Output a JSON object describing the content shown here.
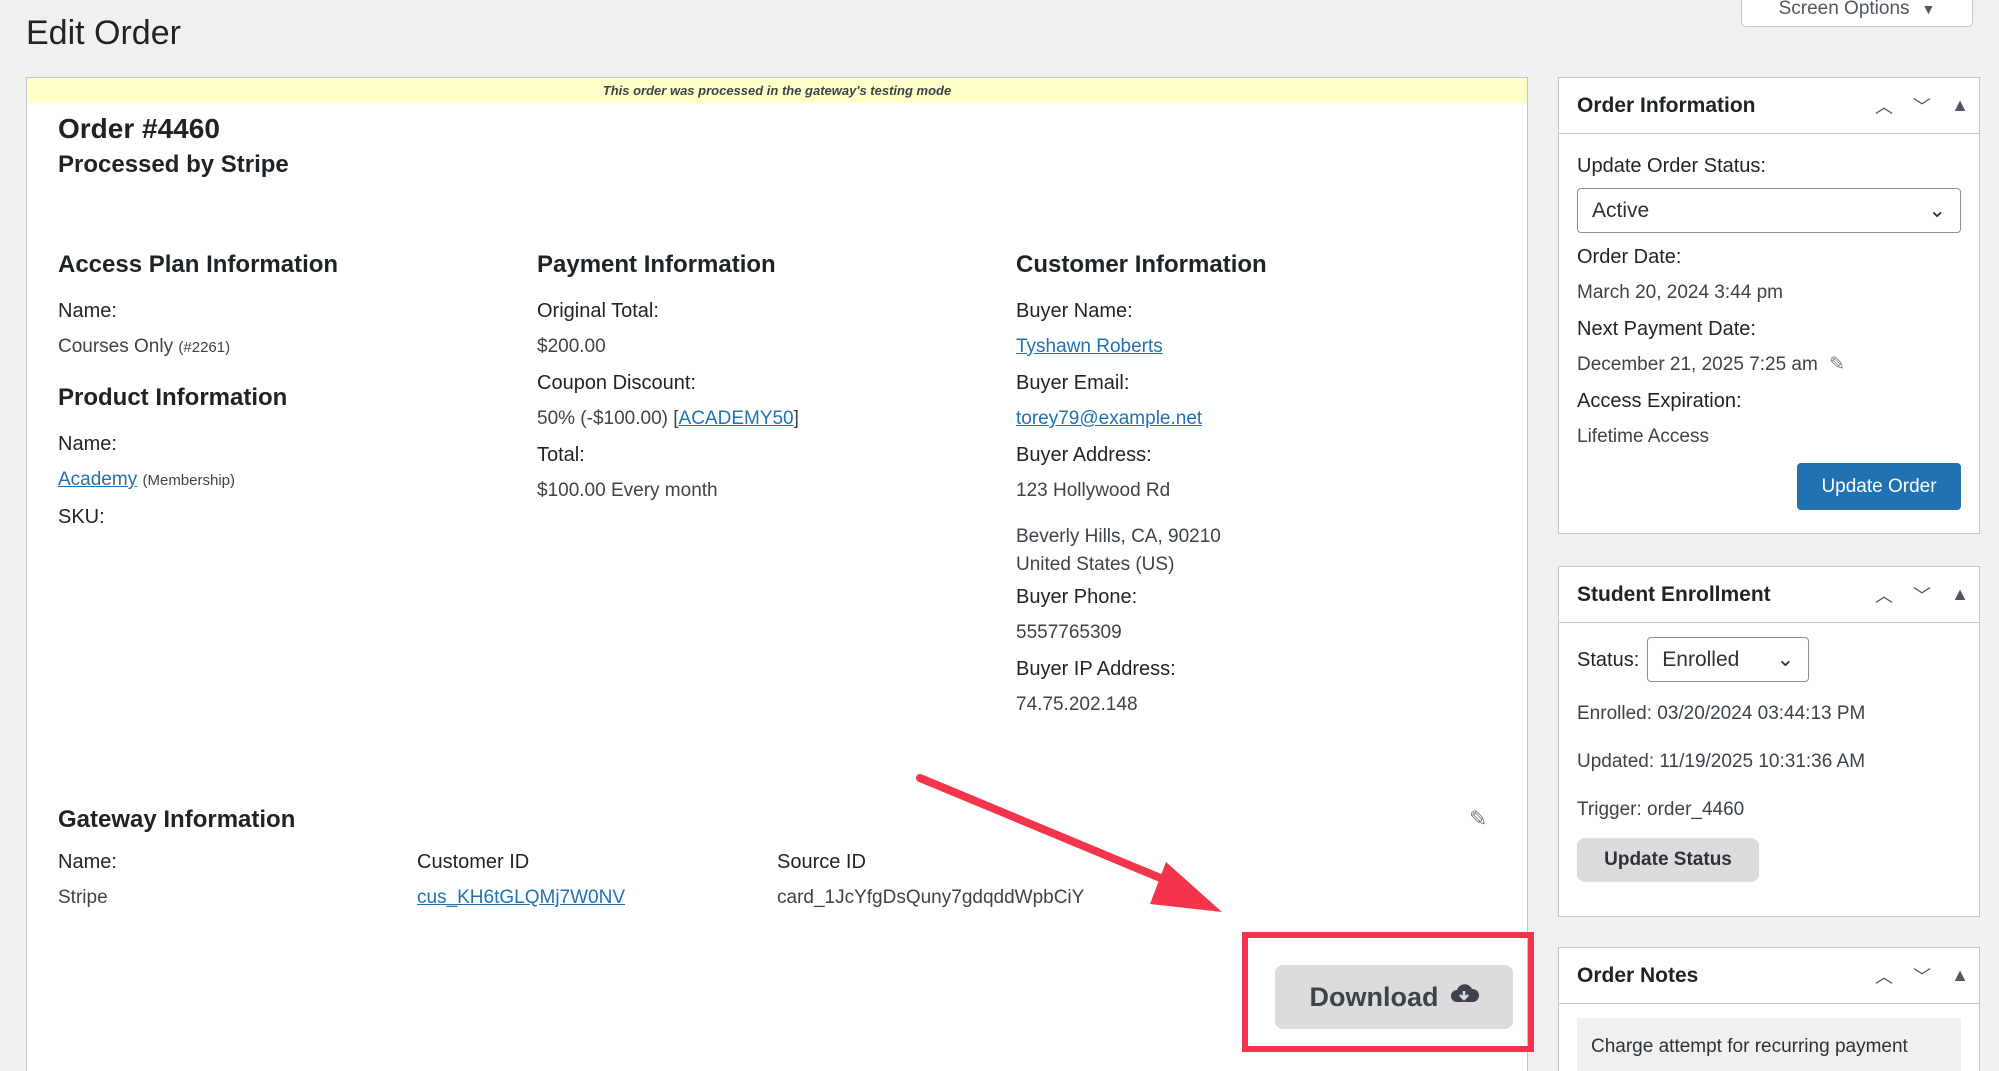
{
  "page": {
    "title": "Edit Order",
    "screen_options": "Screen Options"
  },
  "notice": "This order was processed in the gateway's testing mode",
  "order": {
    "title": "Order #4460",
    "subtitle": "Processed by Stripe"
  },
  "access_plan": {
    "heading": "Access Plan Information",
    "name_label": "Name:",
    "name_value": "Courses Only",
    "name_id": "(#2261)"
  },
  "product": {
    "heading": "Product Information",
    "name_label": "Name:",
    "name_link": "Academy",
    "name_type": "(Membership)",
    "sku_label": "SKU:"
  },
  "payment": {
    "heading": "Payment Information",
    "original_total_label": "Original Total:",
    "original_total_value": "$200.00",
    "coupon_label": "Coupon Discount:",
    "coupon_value": "50% (-$100.00)",
    "coupon_code": "ACADEMY50",
    "total_label": "Total:",
    "total_value": "$100.00 Every month"
  },
  "customer": {
    "heading": "Customer Information",
    "name_label": "Buyer Name:",
    "name_value": "Tyshawn Roberts",
    "email_label": "Buyer Email:",
    "email_value": "torey79@example.net",
    "address_label": "Buyer Address:",
    "address_line1": "123 Hollywood Rd",
    "address_line2": "Beverly Hills, CA, 90210",
    "address_line3": "United States (US)",
    "phone_label": "Buyer Phone:",
    "phone_value": "5557765309",
    "ip_label": "Buyer IP Address:",
    "ip_value": "74.75.202.148"
  },
  "gateway": {
    "heading": "Gateway Information",
    "name_label": "Name:",
    "name_value": "Stripe",
    "customer_id_label": "Customer ID",
    "customer_id_value": "cus_KH6tGLQMj7W0NV",
    "source_id_label": "Source ID",
    "source_id_value": "card_1JcYfgDsQuny7gdqddWpbCiY",
    "download_label": "Download"
  },
  "order_info": {
    "heading": "Order Information",
    "status_label": "Update Order Status:",
    "status_value": "Active",
    "date_label": "Order Date:",
    "date_value": "March 20, 2024 3:44 pm",
    "next_payment_label": "Next Payment Date:",
    "next_payment_value": "December 21, 2025 7:25 am",
    "expiration_label": "Access Expiration:",
    "expiration_value": "Lifetime Access",
    "update_button": "Update Order"
  },
  "enrollment": {
    "heading": "Student Enrollment",
    "status_label": "Status:",
    "status_value": "Enrolled",
    "enrolled": "Enrolled: 03/20/2024 03:44:13 PM",
    "updated": "Updated: 11/19/2025 10:31:36 AM",
    "trigger": "Trigger: order_4460",
    "update_button": "Update Status"
  },
  "notes": {
    "heading": "Order Notes",
    "first_note": "Charge attempt for recurring payment"
  },
  "colors": {
    "accent": "#2271b1",
    "highlight": "#f3344a",
    "notice_bg": "#ffffc8"
  }
}
